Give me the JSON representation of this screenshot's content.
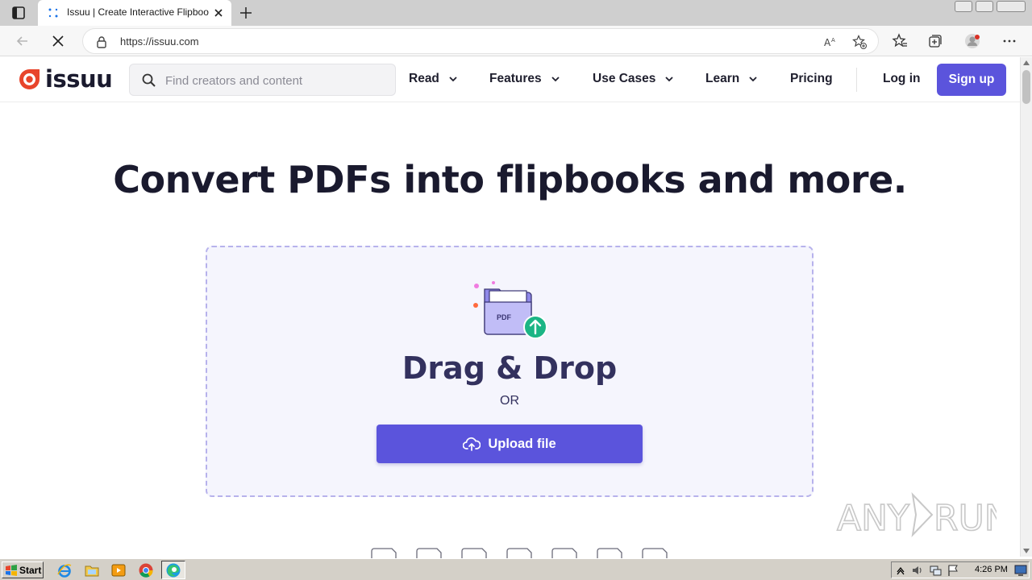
{
  "browser": {
    "tab_title": "Issuu | Create Interactive Flipbooks",
    "url": "https://issuu.com"
  },
  "header": {
    "logo_text": "issuu",
    "search_placeholder": "Find creators and content",
    "nav": [
      {
        "label": "Read"
      },
      {
        "label": "Features"
      },
      {
        "label": "Use Cases"
      },
      {
        "label": "Learn"
      },
      {
        "label": "Pricing"
      }
    ],
    "login_label": "Log in",
    "signup_label": "Sign up"
  },
  "hero": {
    "title": "Convert PDFs into flipbooks and more.",
    "folder_label": "PDF",
    "drag_title": "Drag & Drop",
    "or_text": "OR",
    "upload_label": "Upload file"
  },
  "watermark": {
    "text": "ANY RUN"
  },
  "taskbar": {
    "start_label": "Start",
    "clock": "4:26 PM"
  },
  "colors": {
    "accent": "#5b54dc",
    "brand_red": "#e8452c",
    "dropzone_bg": "#f5f5fd",
    "dropzone_border": "#b7b2ec",
    "heading": "#1a1a2e"
  },
  "icons": {
    "browser": [
      "tab-actions-icon",
      "loading-spinner-icon",
      "close-icon",
      "plus-icon",
      "back-arrow-icon",
      "stop-loading-icon",
      "lock-icon",
      "read-aloud-icon",
      "add-favorite-icon",
      "favorites-icon",
      "collections-icon",
      "profile-avatar-icon",
      "more-icon"
    ],
    "page": [
      "issuu-logo-icon",
      "search-icon",
      "chevron-down-icon",
      "folder-upload-icon",
      "cloud-upload-icon",
      "document-icon"
    ],
    "taskbar": [
      "windows-flag-icon",
      "ie-icon",
      "explorer-icon",
      "media-player-icon",
      "chrome-icon",
      "edge-icon",
      "speaker-icon",
      "network-icon",
      "action-center-icon",
      "monitor-icon"
    ]
  }
}
